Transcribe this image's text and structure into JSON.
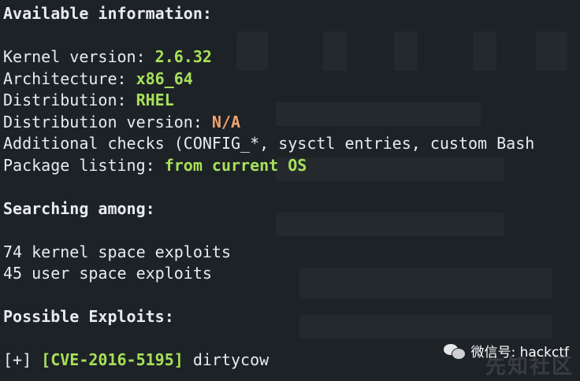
{
  "terminal": {
    "header_available": "Available information:",
    "kernel": {
      "label": "Kernel version: ",
      "value": "2.6.32"
    },
    "arch": {
      "label": "Architecture: ",
      "value": "x86_64"
    },
    "distro": {
      "label": "Distribution: ",
      "value": "RHEL"
    },
    "distro_version": {
      "label": "Distribution version: ",
      "value": "N/A"
    },
    "additional": {
      "label": "Additional checks (CONFIG_*, sysctl entries, custom Bash"
    },
    "package": {
      "label": "Package listing: ",
      "value": "from current OS"
    },
    "header_searching": "Searching among:",
    "kernel_exploits": "74 kernel space exploits",
    "user_exploits": "45 user space exploits",
    "header_possible": "Possible Exploits:",
    "exploit": {
      "prefix": "[+] ",
      "cve": "[CVE-2016-5195]",
      "name": " dirtycow"
    }
  },
  "watermark": {
    "text": "微信号: hackctf",
    "logo": "先知社区"
  },
  "colors": {
    "background": "#1d2227",
    "text": "#e8ecef",
    "value_green": "#a8e05a",
    "value_orange": "#f0a46e"
  }
}
